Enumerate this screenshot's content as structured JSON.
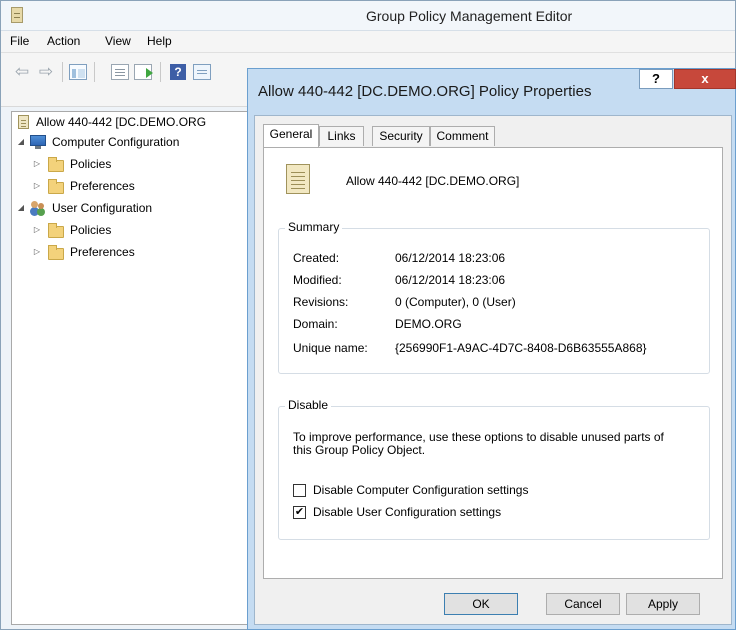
{
  "main_window": {
    "title": "Group Policy Management Editor",
    "menu": [
      "File",
      "Action",
      "View",
      "Help"
    ]
  },
  "toolbar": {
    "back_icon": "arrow-left-icon",
    "forward_icon": "arrow-right-icon",
    "help_glyph": "?"
  },
  "tree": {
    "root": "Allow 440-442 [DC.DEMO.ORG",
    "computer_configuration": "Computer Configuration",
    "computer_policies": "Policies",
    "computer_preferences": "Preferences",
    "user_configuration": "User Configuration",
    "user_policies": "Policies",
    "user_preferences": "Preferences"
  },
  "dialog": {
    "title": "Allow 440-442 [DC.DEMO.ORG] Policy Properties",
    "help_glyph": "?",
    "close_glyph": "x",
    "tabs": [
      "General",
      "Links",
      "Security",
      "Comment"
    ],
    "active_tab": "General",
    "gpo_name": "Allow 440-442 [DC.DEMO.ORG]",
    "summary": {
      "title": "Summary",
      "created_label": "Created:",
      "created_value": "06/12/2014 18:23:06",
      "modified_label": "Modified:",
      "modified_value": "06/12/2014 18:23:06",
      "revisions_label": "Revisions:",
      "revisions_value": "0 (Computer), 0 (User)",
      "domain_label": "Domain:",
      "domain_value": "DEMO.ORG",
      "unique_label": "Unique name:",
      "unique_value": "{256990F1-A9AC-4D7C-8408-D6B63555A868}"
    },
    "disable": {
      "title": "Disable",
      "description": "To improve performance, use these options to disable unused parts of this Group Policy Object.",
      "computer_label": "Disable Computer Configuration settings",
      "computer_checked": false,
      "user_label": "Disable User Configuration settings",
      "user_checked": true,
      "check_glyph": "✔"
    },
    "buttons": {
      "ok": "OK",
      "cancel": "Cancel",
      "apply": "Apply"
    }
  },
  "colors": {
    "dialog_frame": "#c5dcf2",
    "close_button": "#c7483b",
    "folder": "#f3d27b"
  }
}
